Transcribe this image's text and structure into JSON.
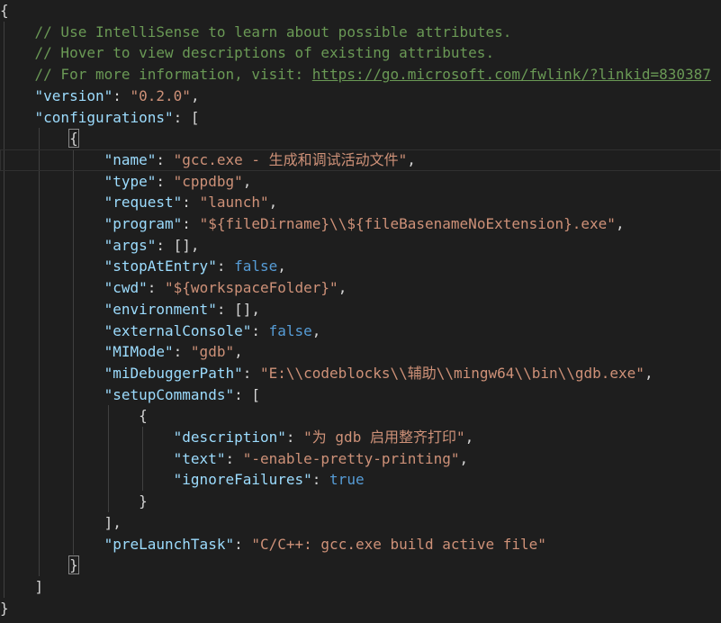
{
  "lines": [
    [
      {
        "t": "{",
        "c": "punc"
      }
    ],
    [
      {
        "t": "    // Use IntelliSense to learn about possible attributes.",
        "c": "comment"
      }
    ],
    [
      {
        "t": "    // Hover to view descriptions of existing attributes.",
        "c": "comment"
      }
    ],
    [
      {
        "t": "    // For more information, visit: ",
        "c": "comment"
      },
      {
        "t": "https://go.microsoft.com/fwlink/?linkid=830387",
        "c": "link"
      }
    ],
    [
      {
        "t": "    ",
        "c": "punc"
      },
      {
        "t": "\"version\"",
        "c": "key"
      },
      {
        "t": ": ",
        "c": "punc"
      },
      {
        "t": "\"0.2.0\"",
        "c": "str"
      },
      {
        "t": ",",
        "c": "punc"
      }
    ],
    [
      {
        "t": "    ",
        "c": "punc"
      },
      {
        "t": "\"configurations\"",
        "c": "key"
      },
      {
        "t": ": [",
        "c": "punc"
      }
    ],
    [
      {
        "t": "        ",
        "c": "punc"
      },
      {
        "t": "{",
        "c": "punc",
        "box": true
      }
    ],
    [
      {
        "t": "            ",
        "c": "punc"
      },
      {
        "t": "\"name\"",
        "c": "key"
      },
      {
        "t": ": ",
        "c": "punc"
      },
      {
        "t": "\"gcc.exe - 生成和调试活动文件\"",
        "c": "str"
      },
      {
        "t": ",",
        "c": "punc"
      }
    ],
    [
      {
        "t": "            ",
        "c": "punc"
      },
      {
        "t": "\"type\"",
        "c": "key"
      },
      {
        "t": ": ",
        "c": "punc"
      },
      {
        "t": "\"cppdbg\"",
        "c": "str"
      },
      {
        "t": ",",
        "c": "punc"
      }
    ],
    [
      {
        "t": "            ",
        "c": "punc"
      },
      {
        "t": "\"request\"",
        "c": "key"
      },
      {
        "t": ": ",
        "c": "punc"
      },
      {
        "t": "\"launch\"",
        "c": "str"
      },
      {
        "t": ",",
        "c": "punc"
      }
    ],
    [
      {
        "t": "            ",
        "c": "punc"
      },
      {
        "t": "\"program\"",
        "c": "key"
      },
      {
        "t": ": ",
        "c": "punc"
      },
      {
        "t": "\"${fileDirname}\\\\${fileBasenameNoExtension}.exe\"",
        "c": "str"
      },
      {
        "t": ",",
        "c": "punc"
      }
    ],
    [
      {
        "t": "            ",
        "c": "punc"
      },
      {
        "t": "\"args\"",
        "c": "key"
      },
      {
        "t": ": [],",
        "c": "punc"
      }
    ],
    [
      {
        "t": "            ",
        "c": "punc"
      },
      {
        "t": "\"stopAtEntry\"",
        "c": "key"
      },
      {
        "t": ": ",
        "c": "punc"
      },
      {
        "t": "false",
        "c": "kw"
      },
      {
        "t": ",",
        "c": "punc"
      }
    ],
    [
      {
        "t": "            ",
        "c": "punc"
      },
      {
        "t": "\"cwd\"",
        "c": "key"
      },
      {
        "t": ": ",
        "c": "punc"
      },
      {
        "t": "\"${workspaceFolder}\"",
        "c": "str"
      },
      {
        "t": ",",
        "c": "punc"
      }
    ],
    [
      {
        "t": "            ",
        "c": "punc"
      },
      {
        "t": "\"environment\"",
        "c": "key"
      },
      {
        "t": ": [],",
        "c": "punc"
      }
    ],
    [
      {
        "t": "            ",
        "c": "punc"
      },
      {
        "t": "\"externalConsole\"",
        "c": "key"
      },
      {
        "t": ": ",
        "c": "punc"
      },
      {
        "t": "false",
        "c": "kw"
      },
      {
        "t": ",",
        "c": "punc"
      }
    ],
    [
      {
        "t": "            ",
        "c": "punc"
      },
      {
        "t": "\"MIMode\"",
        "c": "key"
      },
      {
        "t": ": ",
        "c": "punc"
      },
      {
        "t": "\"gdb\"",
        "c": "str"
      },
      {
        "t": ",",
        "c": "punc"
      }
    ],
    [
      {
        "t": "            ",
        "c": "punc"
      },
      {
        "t": "\"miDebuggerPath\"",
        "c": "key"
      },
      {
        "t": ": ",
        "c": "punc"
      },
      {
        "t": "\"E:\\\\codeblocks\\\\辅助\\\\mingw64\\\\bin\\\\gdb.exe\"",
        "c": "str"
      },
      {
        "t": ",",
        "c": "punc"
      }
    ],
    [
      {
        "t": "            ",
        "c": "punc"
      },
      {
        "t": "\"setupCommands\"",
        "c": "key"
      },
      {
        "t": ": [",
        "c": "punc"
      }
    ],
    [
      {
        "t": "                {",
        "c": "punc"
      }
    ],
    [
      {
        "t": "                    ",
        "c": "punc"
      },
      {
        "t": "\"description\"",
        "c": "key"
      },
      {
        "t": ": ",
        "c": "punc"
      },
      {
        "t": "\"为 gdb 启用整齐打印\"",
        "c": "str"
      },
      {
        "t": ",",
        "c": "punc"
      }
    ],
    [
      {
        "t": "                    ",
        "c": "punc"
      },
      {
        "t": "\"text\"",
        "c": "key"
      },
      {
        "t": ": ",
        "c": "punc"
      },
      {
        "t": "\"-enable-pretty-printing\"",
        "c": "str"
      },
      {
        "t": ",",
        "c": "punc"
      }
    ],
    [
      {
        "t": "                    ",
        "c": "punc"
      },
      {
        "t": "\"ignoreFailures\"",
        "c": "key"
      },
      {
        "t": ": ",
        "c": "punc"
      },
      {
        "t": "true",
        "c": "kw"
      }
    ],
    [
      {
        "t": "                }",
        "c": "punc"
      }
    ],
    [
      {
        "t": "            ],",
        "c": "punc"
      }
    ],
    [
      {
        "t": "            ",
        "c": "punc"
      },
      {
        "t": "\"preLaunchTask\"",
        "c": "key"
      },
      {
        "t": ": ",
        "c": "punc"
      },
      {
        "t": "\"C/C++: gcc.exe build active file\"",
        "c": "str"
      }
    ],
    [
      {
        "t": "        ",
        "c": "punc"
      },
      {
        "t": "}",
        "c": "punc",
        "box": true
      }
    ],
    [
      {
        "t": "    ]",
        "c": "punc"
      }
    ],
    [
      {
        "t": "}",
        "c": "punc"
      }
    ]
  ],
  "colors": {
    "background": "#1e1e1e",
    "comment": "#6a9955",
    "key": "#9cdcfe",
    "string": "#ce9178",
    "keyword": "#569cd6",
    "punctuation": "#d4d4d4"
  }
}
